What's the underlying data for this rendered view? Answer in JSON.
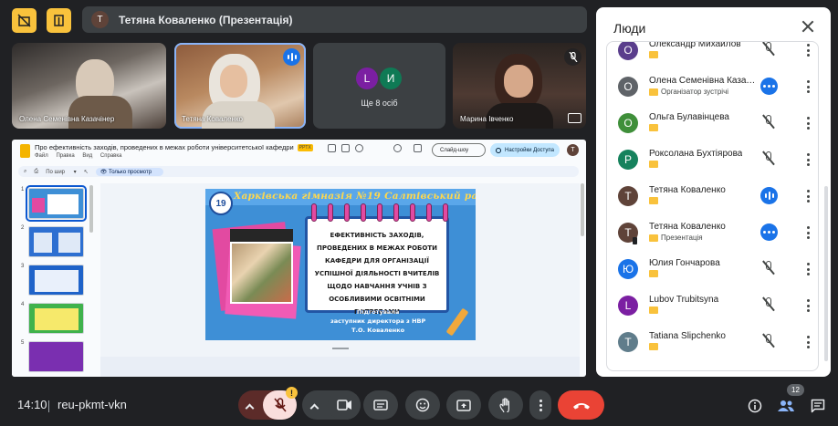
{
  "top": {
    "presenter_initial": "Т",
    "presentation_label": "Тетяна Коваленко (Презентація)"
  },
  "tiles": [
    {
      "name": "Олена Семенівна Казачінер"
    },
    {
      "name": "Тетяна Коваленко"
    },
    {
      "avatars": [
        "L",
        "И"
      ],
      "more_label": "Ще 8 осіб"
    },
    {
      "name": "Марина Івченко"
    }
  ],
  "slides_app": {
    "doc_title": "Про ефективність заходів, проведених в межах роботи університетської кафедри",
    "badge": "PPTX",
    "menu": [
      "Файл",
      "Правка",
      "Вид",
      "Справка"
    ],
    "slideshow_label": "Слайд-шоу",
    "access_label": "Настройки Доступа",
    "user_initial": "Т",
    "zoom_label": "По шир",
    "view_only_label": "Только просмотр",
    "thumbnail_numbers": [
      "1",
      "2",
      "3",
      "4",
      "5"
    ],
    "slide": {
      "school": "Харківська гімназія №19   Салтівський район",
      "badge_number": "19",
      "main_text": "ЕФЕКТИВНІСТЬ ЗАХОДІВ, ПРОВЕДЕНИХ В МЕЖАХ РОБОТИ КАФЕДРИ ДЛЯ ОРГАНІЗАЦІЇ УСПІШНОЇ ДІЯЛЬНОСТІ ВЧИТЕЛІВ ЩОДО НАВЧАННЯ УЧНІВ З ОСОБЛИВИМИ ОСВІТНІМИ ПОТРЕБАМИ",
      "prepared_by_1": "Підготувала",
      "prepared_by_2": "заступник директора з НВР",
      "prepared_by_3": "Т.О. Коваленко"
    }
  },
  "people_panel": {
    "title": "Люди",
    "participants": [
      {
        "initial": "О",
        "name": "Олександр Михайлов",
        "subtitle": "",
        "color": "#5a3e8c",
        "state": "muted"
      },
      {
        "initial": "О",
        "name": "Олена Семенівна Казачінер",
        "subtitle": "Організатор зустрічі",
        "color": "#5f6368",
        "state": "more"
      },
      {
        "initial": "О",
        "name": "Ольга Булавінцева",
        "subtitle": "",
        "color": "#3f8f3a",
        "state": "muted"
      },
      {
        "initial": "Р",
        "name": "Роксолана Бухтіярова",
        "subtitle": "",
        "color": "#16825d",
        "state": "muted"
      },
      {
        "initial": "Т",
        "name": "Тетяна Коваленко",
        "subtitle": "",
        "color": "#5f4339",
        "state": "speaking"
      },
      {
        "initial": "Т",
        "name": "Тетяна Коваленко",
        "subtitle": "Презентація",
        "color": "#5f4339",
        "state": "more"
      },
      {
        "initial": "Ю",
        "name": "Юлия Гончарова",
        "subtitle": "",
        "color": "#1a73e8",
        "state": "muted"
      },
      {
        "initial": "L",
        "name": "Lubov Trubitsyna",
        "subtitle": "",
        "color": "#7b1fa2",
        "state": "muted"
      },
      {
        "initial": "T",
        "name": "Tatiana Slipchenko",
        "subtitle": "",
        "color": "#607d8b",
        "state": "muted"
      }
    ]
  },
  "bottom_bar": {
    "time": "14:10",
    "meeting_code": "reu-pkmt-vkn",
    "warning": "!",
    "people_count": "12"
  }
}
